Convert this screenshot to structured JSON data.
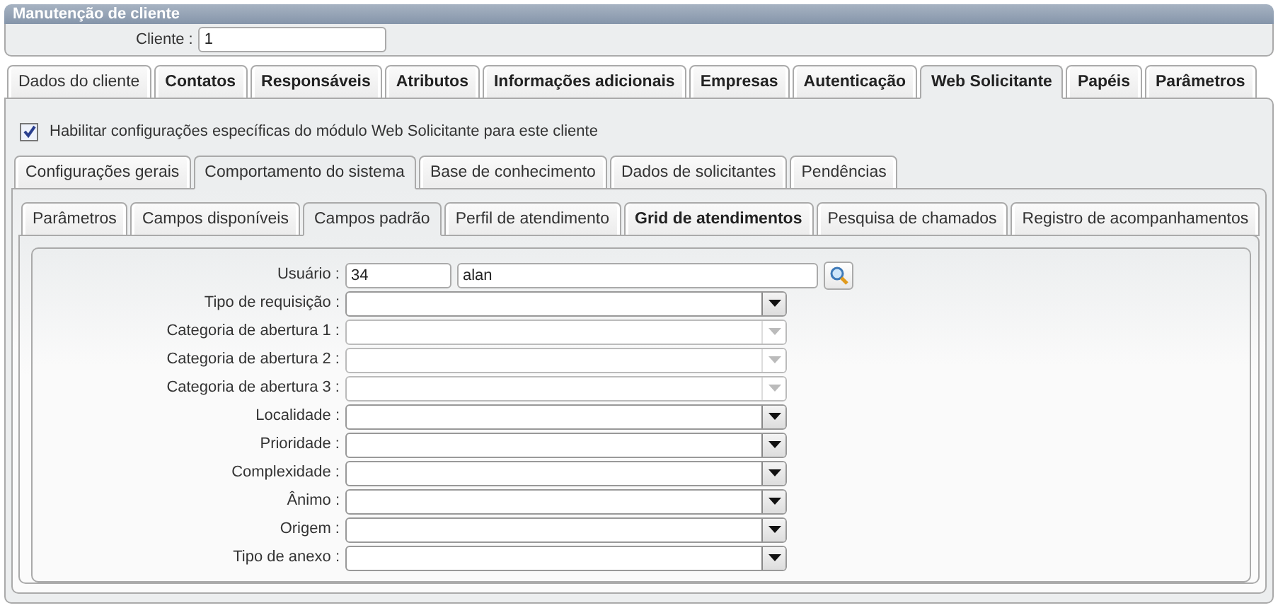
{
  "window": {
    "title": "Manutenção de cliente"
  },
  "client": {
    "label": "Cliente :",
    "value": "1"
  },
  "tabs": [
    {
      "label": "Dados do cliente",
      "selected": false,
      "emphasized": false
    },
    {
      "label": "Contatos",
      "selected": false,
      "emphasized": true
    },
    {
      "label": "Responsáveis",
      "selected": false,
      "emphasized": true
    },
    {
      "label": "Atributos",
      "selected": false,
      "emphasized": true
    },
    {
      "label": "Informações adicionais",
      "selected": false,
      "emphasized": true
    },
    {
      "label": "Empresas",
      "selected": false,
      "emphasized": true
    },
    {
      "label": "Autenticação",
      "selected": false,
      "emphasized": true
    },
    {
      "label": "Web Solicitante",
      "selected": true,
      "emphasized": true
    },
    {
      "label": "Papéis",
      "selected": false,
      "emphasized": true
    },
    {
      "label": "Parâmetros",
      "selected": false,
      "emphasized": true
    }
  ],
  "enable_checkbox": {
    "label": "Habilitar configurações específicas do módulo Web Solicitante para este cliente",
    "checked": true
  },
  "sub_tabs": [
    {
      "label": "Configurações gerais",
      "selected": false,
      "emphasized": false
    },
    {
      "label": "Comportamento do sistema",
      "selected": true,
      "emphasized": false
    },
    {
      "label": "Base de conhecimento",
      "selected": false,
      "emphasized": false
    },
    {
      "label": "Dados de solicitantes",
      "selected": false,
      "emphasized": false
    },
    {
      "label": "Pendências",
      "selected": false,
      "emphasized": false
    }
  ],
  "section_tabs": [
    {
      "label": "Parâmetros",
      "selected": false,
      "emphasized": false
    },
    {
      "label": "Campos disponíveis",
      "selected": false,
      "emphasized": false
    },
    {
      "label": "Campos padrão",
      "selected": true,
      "emphasized": false
    },
    {
      "label": "Perfil de atendimento",
      "selected": false,
      "emphasized": false
    },
    {
      "label": "Grid de atendimentos",
      "selected": false,
      "emphasized": true
    },
    {
      "label": "Pesquisa de chamados",
      "selected": false,
      "emphasized": false
    },
    {
      "label": "Registro de acompanhamentos",
      "selected": false,
      "emphasized": false
    }
  ],
  "fields": [
    {
      "kind": "lookup",
      "label": "Usuário :",
      "code": "34",
      "value": "alan"
    },
    {
      "kind": "select",
      "label": "Tipo de requisição :",
      "disabled": false
    },
    {
      "kind": "select",
      "label": "Categoria de abertura 1 :",
      "disabled": true
    },
    {
      "kind": "select",
      "label": "Categoria de abertura 2 :",
      "disabled": true
    },
    {
      "kind": "select",
      "label": "Categoria de abertura 3 :",
      "disabled": true
    },
    {
      "kind": "select",
      "label": "Localidade :",
      "disabled": false
    },
    {
      "kind": "select",
      "label": "Prioridade :",
      "disabled": false
    },
    {
      "kind": "select",
      "label": "Complexidade :",
      "disabled": false
    },
    {
      "kind": "select",
      "label": "Ânimo :",
      "disabled": false
    },
    {
      "kind": "select",
      "label": "Origem :",
      "disabled": false
    },
    {
      "kind": "select",
      "label": "Tipo de anexo :",
      "disabled": false
    }
  ]
}
